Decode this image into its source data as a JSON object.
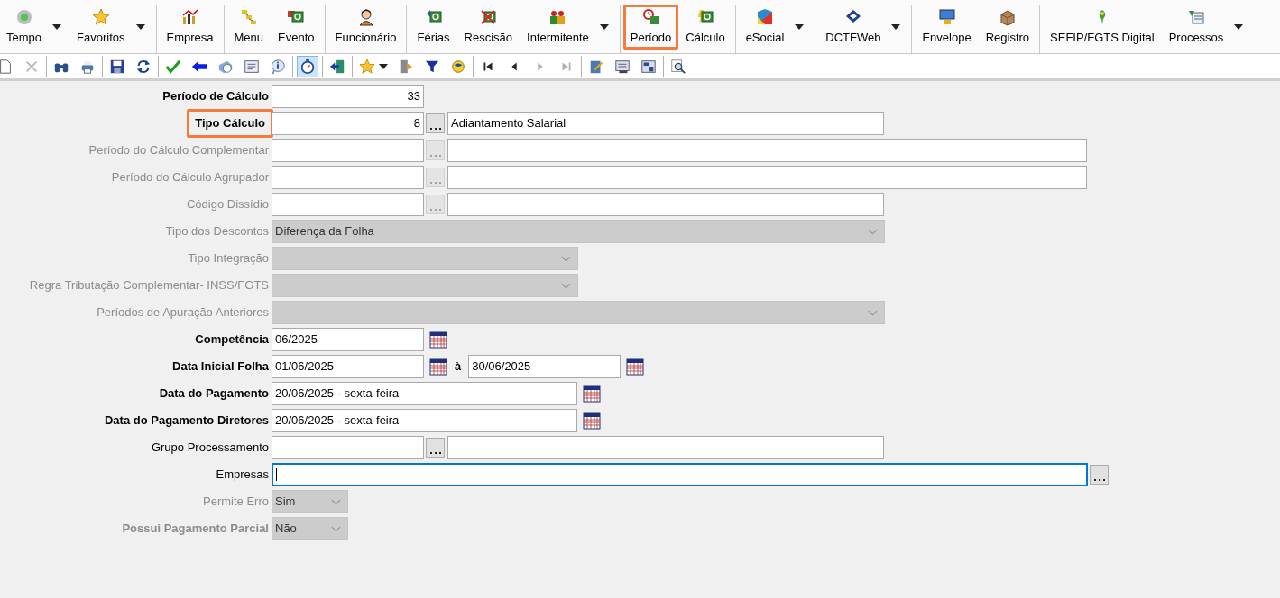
{
  "toolbar": {
    "groups": [
      [
        {
          "label": "Tempo",
          "dropdown": true,
          "highlighted": false
        },
        {
          "label": "Favoritos",
          "dropdown": true,
          "highlighted": false
        }
      ],
      [
        {
          "label": "Empresa",
          "dropdown": false,
          "highlighted": false
        }
      ],
      [
        {
          "label": "Menu",
          "dropdown": false,
          "highlighted": false
        },
        {
          "label": "Evento",
          "dropdown": false,
          "highlighted": false
        }
      ],
      [
        {
          "label": "Funcionário",
          "dropdown": false,
          "highlighted": false
        }
      ],
      [
        {
          "label": "Férias",
          "dropdown": false,
          "highlighted": false
        },
        {
          "label": "Rescisão",
          "dropdown": false,
          "highlighted": false
        },
        {
          "label": "Intermitente",
          "dropdown": true,
          "highlighted": false
        }
      ],
      [
        {
          "label": "Período",
          "dropdown": false,
          "highlighted": true
        },
        {
          "label": "Cálculo",
          "dropdown": false,
          "highlighted": false
        }
      ],
      [
        {
          "label": "eSocial",
          "dropdown": true,
          "highlighted": false
        }
      ],
      [
        {
          "label": "DCTFWeb",
          "dropdown": true,
          "highlighted": false
        }
      ],
      [
        {
          "label": "Envelope",
          "dropdown": false,
          "highlighted": false
        },
        {
          "label": "Registro",
          "dropdown": false,
          "highlighted": false
        }
      ],
      [
        {
          "label": "SEFIP/FGTS Digital",
          "dropdown": false,
          "highlighted": false
        },
        {
          "label": "Processos",
          "dropdown": true,
          "highlighted": false
        }
      ]
    ]
  },
  "tool_strip": {
    "groups": [
      [
        {
          "pressed": false,
          "disabled": false,
          "dropdown": false
        },
        {
          "pressed": false,
          "disabled": true,
          "dropdown": false
        }
      ],
      [
        {
          "pressed": false,
          "disabled": false,
          "dropdown": false
        },
        {
          "pressed": false,
          "disabled": false,
          "dropdown": false
        }
      ],
      [
        {
          "pressed": false,
          "disabled": false,
          "dropdown": false
        },
        {
          "pressed": false,
          "disabled": false,
          "dropdown": false
        }
      ],
      [
        {
          "pressed": false,
          "disabled": false,
          "dropdown": false
        },
        {
          "pressed": false,
          "disabled": false,
          "dropdown": false
        },
        {
          "pressed": false,
          "disabled": false,
          "dropdown": false
        },
        {
          "pressed": false,
          "disabled": false,
          "dropdown": false
        },
        {
          "pressed": false,
          "disabled": false,
          "dropdown": false
        }
      ],
      [
        {
          "pressed": true,
          "disabled": false,
          "dropdown": false
        }
      ],
      [
        {
          "pressed": false,
          "disabled": false,
          "dropdown": false
        }
      ],
      [
        {
          "pressed": false,
          "disabled": false,
          "dropdown": true
        },
        {
          "pressed": false,
          "disabled": false,
          "dropdown": false
        },
        {
          "pressed": false,
          "disabled": false,
          "dropdown": false
        },
        {
          "pressed": false,
          "disabled": false,
          "dropdown": false
        }
      ],
      [
        {
          "pressed": false,
          "disabled": false,
          "dropdown": false
        },
        {
          "pressed": false,
          "disabled": false,
          "dropdown": false
        },
        {
          "pressed": false,
          "disabled": true,
          "dropdown": false
        },
        {
          "pressed": false,
          "disabled": true,
          "dropdown": false
        }
      ],
      [
        {
          "pressed": false,
          "disabled": false,
          "dropdown": false
        },
        {
          "pressed": false,
          "disabled": false,
          "dropdown": false
        },
        {
          "pressed": false,
          "disabled": false,
          "dropdown": false
        }
      ],
      [
        {
          "pressed": false,
          "disabled": false,
          "dropdown": false
        }
      ]
    ]
  },
  "form": {
    "fields": [
      {
        "label": "Período de Cálculo",
        "bold": true,
        "disabled": false,
        "highlighted": false,
        "focused": false,
        "kind": "code",
        "value": "33"
      },
      {
        "label": "Tipo Cálculo",
        "bold": true,
        "disabled": false,
        "highlighted": true,
        "focused": false,
        "kind": "lookup",
        "value": "8",
        "description": "Adiantamento Salarial"
      },
      {
        "label": "Período do Cálculo Complementar",
        "bold": false,
        "disabled": true,
        "highlighted": false,
        "focused": false,
        "kind": "lookup_wide"
      },
      {
        "label": "Período do Cálculo Agrupador",
        "bold": false,
        "disabled": true,
        "highlighted": false,
        "focused": false,
        "kind": "lookup_wide"
      },
      {
        "label": "Código Dissídio",
        "bold": false,
        "disabled": true,
        "highlighted": false,
        "focused": false,
        "kind": "lookup"
      },
      {
        "label": "Tipo dos Descontos",
        "bold": false,
        "disabled": true,
        "highlighted": false,
        "focused": false,
        "kind": "select_wide",
        "value": "Diferença da Folha"
      },
      {
        "label": "Tipo Integração",
        "bold": false,
        "disabled": true,
        "highlighted": false,
        "focused": false,
        "kind": "select"
      },
      {
        "label": "Regra Tributação Complementar- INSS/FGTS",
        "bold": false,
        "disabled": true,
        "highlighted": false,
        "focused": false,
        "kind": "select"
      },
      {
        "label": "Períodos de Apuração Anteriores",
        "bold": false,
        "disabled": true,
        "highlighted": false,
        "focused": false,
        "kind": "select_wide"
      },
      {
        "label": "Competência",
        "bold": true,
        "disabled": false,
        "highlighted": false,
        "focused": false,
        "kind": "date",
        "value": "06/2025"
      },
      {
        "label": "Data Inicial Folha",
        "bold": true,
        "disabled": false,
        "highlighted": false,
        "focused": false,
        "kind": "date_range",
        "value": "01/06/2025",
        "separator": "à",
        "value_end": "30/06/2025"
      },
      {
        "label": "Data do Pagamento",
        "bold": true,
        "disabled": false,
        "highlighted": false,
        "focused": false,
        "kind": "date_long",
        "value": "20/06/2025 - sexta-feira"
      },
      {
        "label": "Data do Pagamento Diretores",
        "bold": true,
        "disabled": false,
        "highlighted": false,
        "focused": false,
        "kind": "date_long",
        "value": "20/06/2025 - sexta-feira"
      },
      {
        "label": "Grupo Processamento",
        "bold": false,
        "disabled": false,
        "highlighted": false,
        "focused": false,
        "kind": "lookup"
      },
      {
        "label": "Empresas",
        "bold": false,
        "disabled": false,
        "highlighted": false,
        "focused": true,
        "kind": "multi"
      },
      {
        "label": "Permite Erro",
        "bold": false,
        "disabled": true,
        "highlighted": false,
        "focused": false,
        "kind": "select_short",
        "value": "Sim"
      },
      {
        "label": "Possui Pagamento Parcial",
        "bold": true,
        "disabled": true,
        "highlighted": false,
        "focused": false,
        "kind": "select_short",
        "value": "Não"
      }
    ]
  }
}
